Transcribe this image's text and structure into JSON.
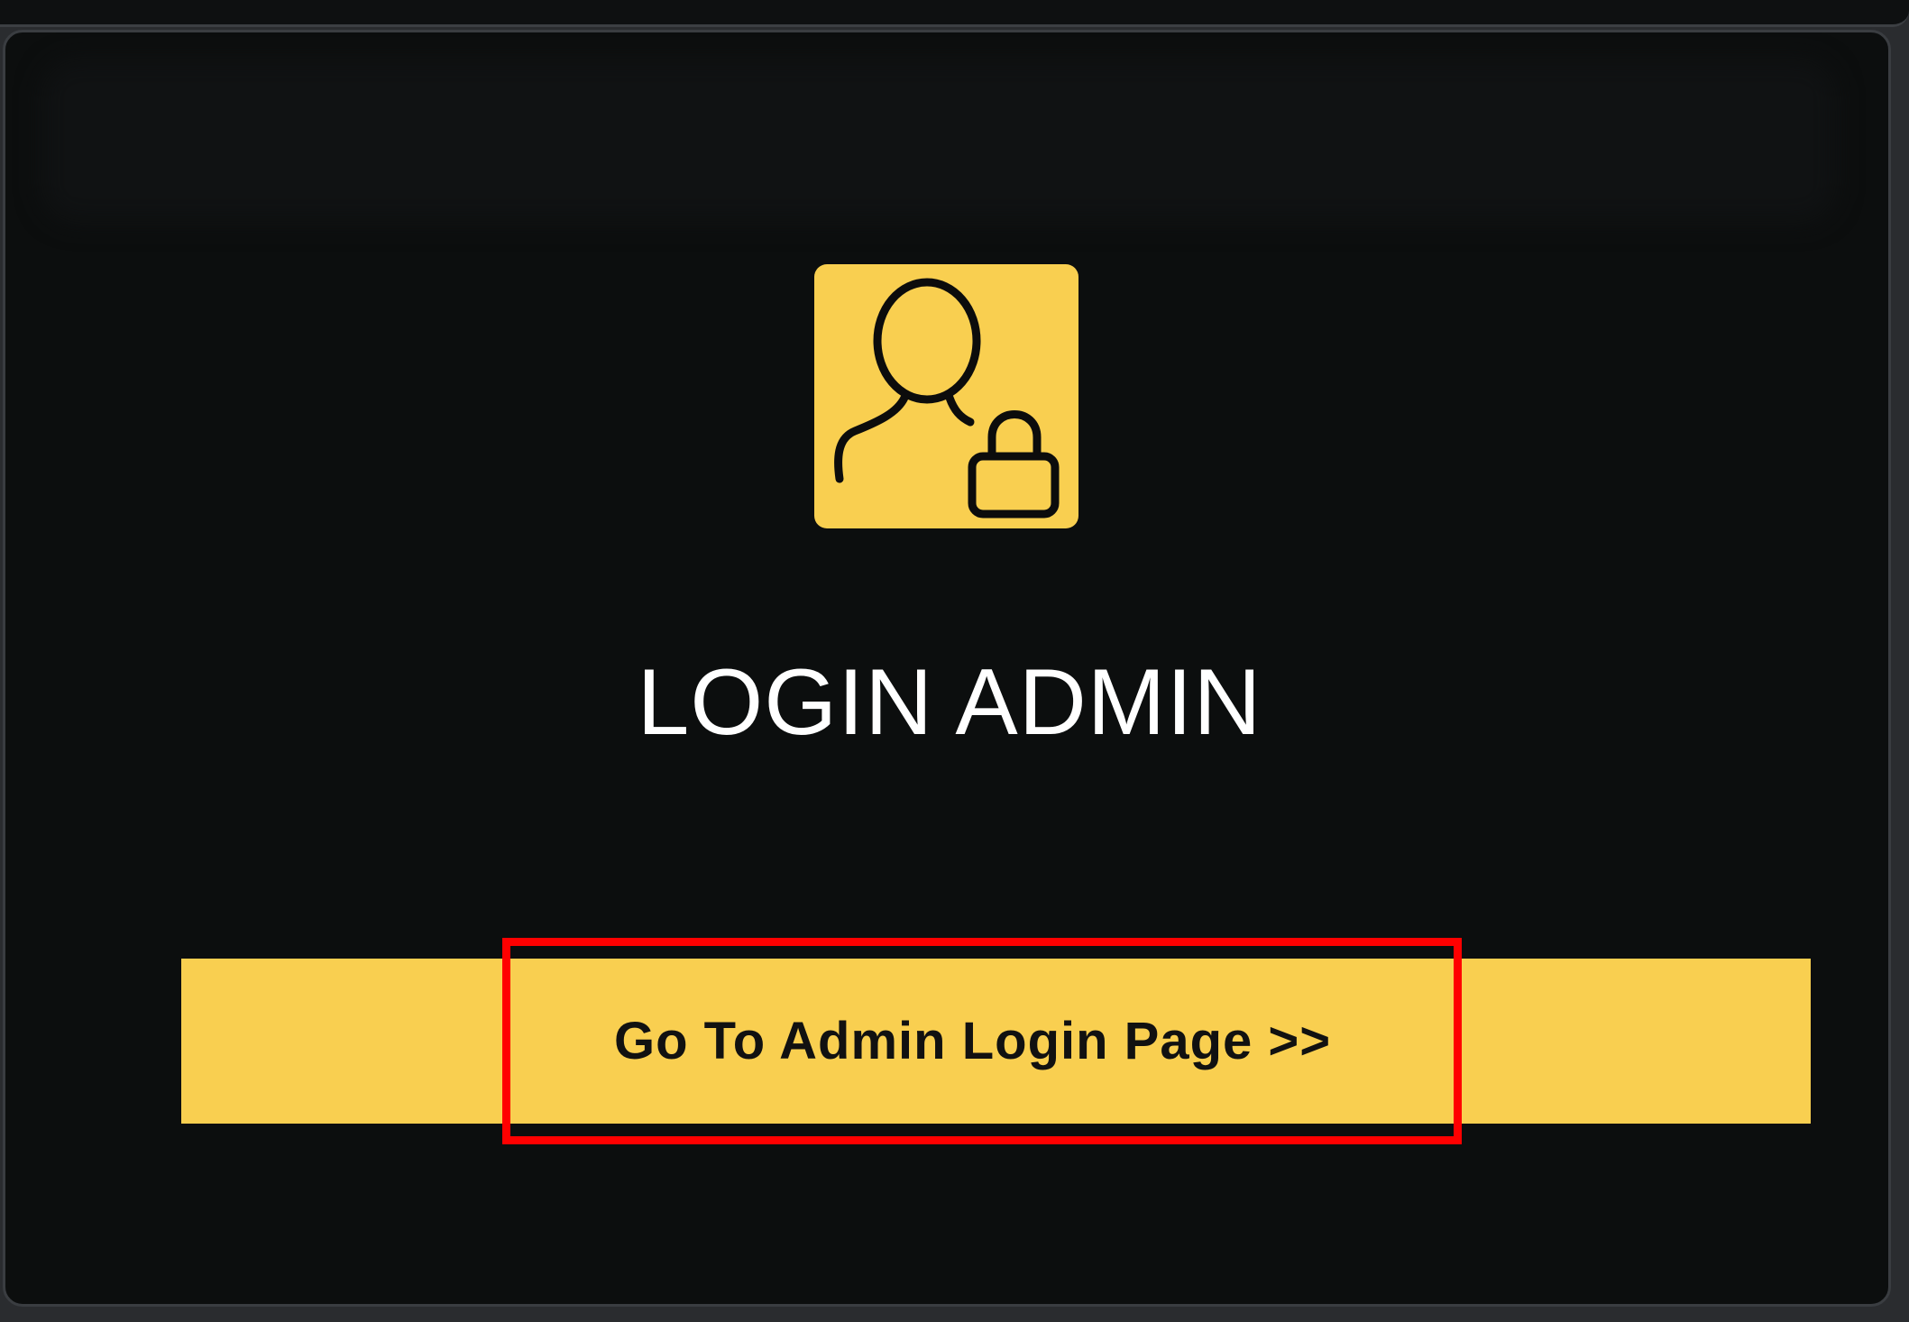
{
  "card": {
    "title": "LOGIN ADMIN",
    "icon": "user-lock-icon",
    "button_label": "Go To Admin Login Page >>"
  },
  "colors": {
    "background": "#0c0e0e",
    "accent": "#f9cf50",
    "title_text": "#ffffff",
    "highlight": "#ff0000"
  }
}
